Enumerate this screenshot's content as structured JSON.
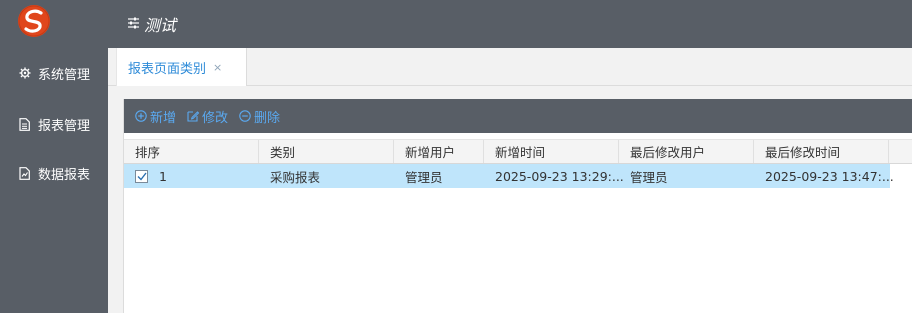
{
  "app": {
    "title": "测试"
  },
  "sidebar": {
    "items": [
      {
        "label": "系统管理",
        "icon": "gear-icon"
      },
      {
        "label": "报表管理",
        "icon": "document-icon"
      },
      {
        "label": "数据报表",
        "icon": "report-icon"
      }
    ]
  },
  "tabs": [
    {
      "label": "报表页面类别",
      "close": "×"
    }
  ],
  "toolbar": {
    "add_label": "新增",
    "edit_label": "修改",
    "delete_label": "删除"
  },
  "grid": {
    "columns": [
      "排序",
      "类别",
      "新增用户",
      "新增时间",
      "最后修改用户",
      "最后修改时间"
    ],
    "rows": [
      {
        "selected": true,
        "cells": [
          "1",
          "采购报表",
          "管理员",
          "2025-09-23 13:29:...",
          "管理员",
          "2025-09-23 13:47:..."
        ]
      }
    ]
  },
  "colors": {
    "chrome": "#585e66",
    "accent": "#2e8bd8",
    "toolbar_text": "#5aa9f0",
    "selected_row": "#bfe5fb",
    "logo": "#e0461c"
  }
}
